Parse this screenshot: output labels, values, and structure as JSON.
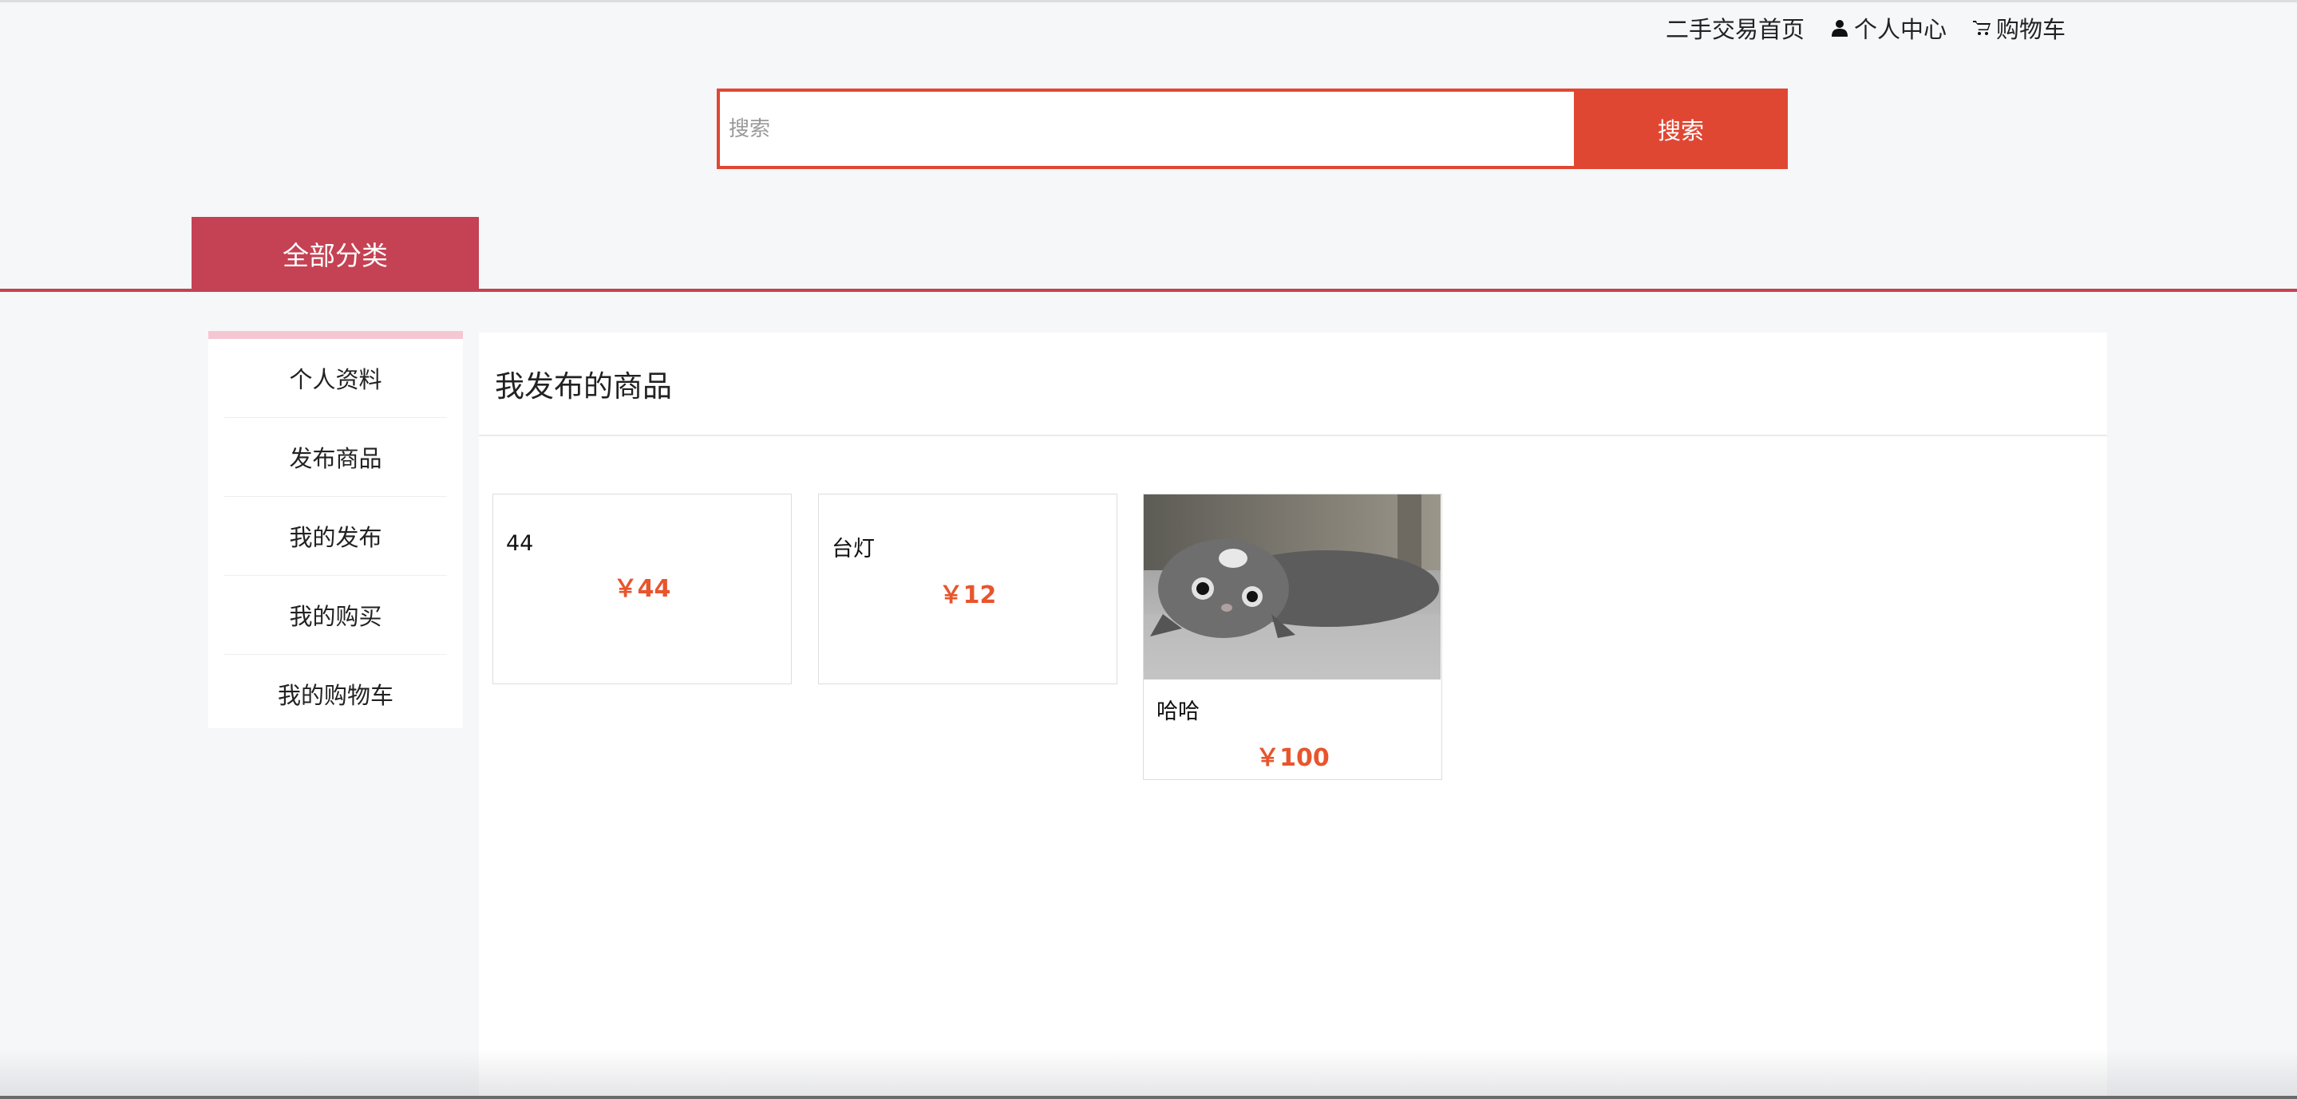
{
  "topnav": {
    "home_label": "二手交易首页",
    "profile_label": "个人中心",
    "cart_label": "购物车"
  },
  "search": {
    "placeholder": "搜索",
    "button_label": "搜索"
  },
  "category": {
    "label": "全部分类"
  },
  "sidebar": {
    "items": [
      {
        "label": "个人资料"
      },
      {
        "label": "发布商品"
      },
      {
        "label": "我的发布"
      },
      {
        "label": "我的购买"
      },
      {
        "label": "我的购物车"
      }
    ]
  },
  "main": {
    "title": "我发布的商品",
    "products": [
      {
        "name": "44",
        "price": "￥44"
      },
      {
        "name": "台灯",
        "price": "￥12"
      },
      {
        "name": "哈哈",
        "price": "￥100",
        "image": "cat-photo"
      }
    ]
  },
  "colors": {
    "accent": "#e04733",
    "category": "#c44253",
    "price": "#e8552d",
    "sidebar_top": "#f7c6d3"
  }
}
